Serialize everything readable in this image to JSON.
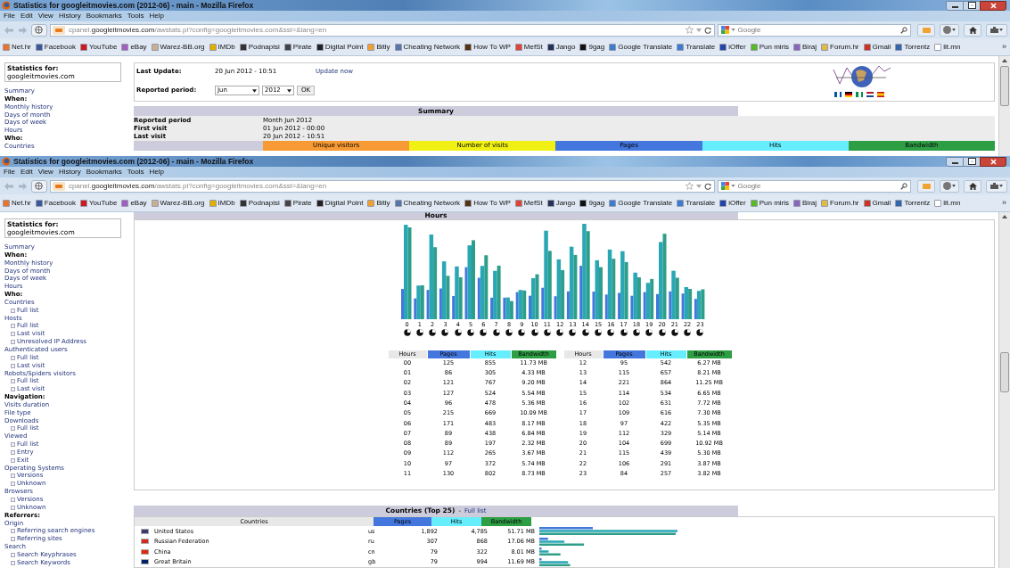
{
  "windows": [
    {
      "title": "Statistics for googleitmovies.com (2012-06) - main - Mozilla Firefox",
      "menu": [
        "File",
        "Edit",
        "View",
        "History",
        "Bookmarks",
        "Tools",
        "Help"
      ],
      "url": {
        "prefix": "cpanel.",
        "domain": "googleitmovies.com",
        "path": "/awstats.pl?config=googleitmovies.com&ssl=&lang=en"
      },
      "search": {
        "placeholder": "Google"
      },
      "bookmarks": [
        {
          "label": "Net.hr",
          "color": "#e8742c"
        },
        {
          "label": "Facebook",
          "color": "#3b5998"
        },
        {
          "label": "YouTube",
          "color": "#cc181e"
        },
        {
          "label": "eBay",
          "color": "#a060c0"
        },
        {
          "label": "Warez-BB.org",
          "color": "#c8b090"
        },
        {
          "label": "IMDb",
          "color": "#e0b000"
        },
        {
          "label": "Podnapisi",
          "color": "#333333"
        },
        {
          "label": "Pirate",
          "color": "#444444"
        },
        {
          "label": "Digital Point",
          "color": "#222222"
        },
        {
          "label": "Bitly",
          "color": "#f0a030"
        },
        {
          "label": "Cheating Network",
          "color": "#5577aa"
        },
        {
          "label": "How To WP",
          "color": "#553311"
        },
        {
          "label": "MefSt",
          "color": "#dd4433"
        },
        {
          "label": "Jango",
          "color": "#223355"
        },
        {
          "label": "9gag",
          "color": "#111111"
        },
        {
          "label": "Google Translate",
          "color": "#3b7cd0"
        },
        {
          "label": "Translate",
          "color": "#3b7cd0"
        },
        {
          "label": "iOffer",
          "color": "#2244aa"
        },
        {
          "label": "Pun miris",
          "color": "#55bb22"
        },
        {
          "label": "Biraj",
          "color": "#8866bb"
        },
        {
          "label": "Forum.hr",
          "color": "#ddbb44"
        },
        {
          "label": "Gmail",
          "color": "#cc3322"
        },
        {
          "label": "Torrentz",
          "color": "#3366aa"
        },
        {
          "label": "lit.mn",
          "color": "#ffffff"
        }
      ],
      "overflow": "»",
      "page": {
        "stats_for": {
          "label": "Statistics for:",
          "domain": "googleitmovies.com"
        },
        "sidebar": [
          {
            "kind": "link",
            "label": "Summary"
          },
          {
            "kind": "heading",
            "label": "When:"
          },
          {
            "kind": "link",
            "label": "Monthly history"
          },
          {
            "kind": "link",
            "label": "Days of month"
          },
          {
            "kind": "link",
            "label": "Days of week"
          },
          {
            "kind": "link",
            "label": "Hours"
          },
          {
            "kind": "heading",
            "label": "Who:"
          },
          {
            "kind": "link",
            "label": "Countries"
          }
        ],
        "update": {
          "last_label": "Last Update:",
          "last_value": "20 Jun 2012 - 10:51",
          "update_link": "Update now",
          "period_label": "Reported period:",
          "month": "Jun",
          "year": "2012",
          "ok": "OK"
        },
        "summary": {
          "title": "Summary",
          "rows": [
            [
              "Reported period",
              "Month Jun 2012"
            ],
            [
              "First visit",
              "01 Jun 2012 - 00:00"
            ],
            [
              "Last visit",
              "20 Jun 2012 - 10:51"
            ]
          ],
          "metrics": [
            {
              "label": "Unique visitors",
              "color": "#f89a33"
            },
            {
              "label": "Number of visits",
              "color": "#f0f015"
            },
            {
              "label": "Pages",
              "color": "#4477dd"
            },
            {
              "label": "Hits",
              "color": "#66eeff"
            },
            {
              "label": "Bandwidth",
              "color": "#2e9e45"
            }
          ]
        }
      }
    },
    {
      "title": "Statistics for googleitmovies.com (2012-06) - main - Mozilla Firefox",
      "menu": [
        "File",
        "Edit",
        "View",
        "History",
        "Bookmarks",
        "Tools",
        "Help"
      ],
      "url": {
        "prefix": "cpanel.",
        "domain": "googleitmovies.com",
        "path": "/awstats.pl?config=googleitmovies.com&ssl=&lang=en"
      },
      "search": {
        "placeholder": "Google"
      },
      "bookmarks": [
        {
          "label": "Net.hr",
          "color": "#e8742c"
        },
        {
          "label": "Facebook",
          "color": "#3b5998"
        },
        {
          "label": "YouTube",
          "color": "#cc181e"
        },
        {
          "label": "eBay",
          "color": "#a060c0"
        },
        {
          "label": "Warez-BB.org",
          "color": "#c8b090"
        },
        {
          "label": "IMDb",
          "color": "#e0b000"
        },
        {
          "label": "Podnapisi",
          "color": "#333333"
        },
        {
          "label": "Pirate",
          "color": "#444444"
        },
        {
          "label": "Digital Point",
          "color": "#222222"
        },
        {
          "label": "Bitly",
          "color": "#f0a030"
        },
        {
          "label": "Cheating Network",
          "color": "#5577aa"
        },
        {
          "label": "How To WP",
          "color": "#553311"
        },
        {
          "label": "MefSt",
          "color": "#dd4433"
        },
        {
          "label": "Jango",
          "color": "#223355"
        },
        {
          "label": "9gag",
          "color": "#111111"
        },
        {
          "label": "Google Translate",
          "color": "#3b7cd0"
        },
        {
          "label": "Translate",
          "color": "#3b7cd0"
        },
        {
          "label": "iOffer",
          "color": "#2244aa"
        },
        {
          "label": "Pun miris",
          "color": "#55bb22"
        },
        {
          "label": "Biraj",
          "color": "#8866bb"
        },
        {
          "label": "Forum.hr",
          "color": "#ddbb44"
        },
        {
          "label": "Gmail",
          "color": "#cc3322"
        },
        {
          "label": "Torrentz",
          "color": "#3366aa"
        },
        {
          "label": "lit.mn",
          "color": "#ffffff"
        }
      ],
      "overflow": "»",
      "page": {
        "stats_for": {
          "label": "Statistics for:",
          "domain": "googleitmovies.com"
        },
        "sidebar": [
          {
            "kind": "link",
            "label": "Summary"
          },
          {
            "kind": "heading",
            "label": "When:"
          },
          {
            "kind": "link",
            "label": "Monthly history"
          },
          {
            "kind": "link",
            "label": "Days of month"
          },
          {
            "kind": "link",
            "label": "Days of week"
          },
          {
            "kind": "link",
            "label": "Hours"
          },
          {
            "kind": "heading",
            "label": "Who:"
          },
          {
            "kind": "link",
            "label": "Countries",
            "children": [
              {
                "label": "Full list"
              }
            ]
          },
          {
            "kind": "link",
            "label": "Hosts",
            "children": [
              {
                "label": "Full list"
              },
              {
                "label": "Last visit"
              },
              {
                "label": "Unresolved IP Address"
              }
            ]
          },
          {
            "kind": "link",
            "label": "Authenticated users",
            "children": [
              {
                "label": "Full list"
              },
              {
                "label": "Last visit"
              }
            ]
          },
          {
            "kind": "link",
            "label": "Robots/Spiders visitors",
            "children": [
              {
                "label": "Full list"
              },
              {
                "label": "Last visit"
              }
            ]
          },
          {
            "kind": "heading",
            "label": "Navigation:"
          },
          {
            "kind": "link",
            "label": "Visits duration"
          },
          {
            "kind": "link",
            "label": "File type"
          },
          {
            "kind": "link",
            "label": "Downloads",
            "children": [
              {
                "label": "Full list"
              }
            ]
          },
          {
            "kind": "link",
            "label": "Viewed",
            "children": [
              {
                "label": "Full list"
              },
              {
                "label": "Entry"
              },
              {
                "label": "Exit"
              }
            ]
          },
          {
            "kind": "link",
            "label": "Operating Systems",
            "children": [
              {
                "label": "Versions"
              },
              {
                "label": "Unknown"
              }
            ]
          },
          {
            "kind": "link",
            "label": "Browsers",
            "children": [
              {
                "label": "Versions"
              },
              {
                "label": "Unknown"
              }
            ]
          },
          {
            "kind": "heading",
            "label": "Referrers:"
          },
          {
            "kind": "link",
            "label": "Origin",
            "children": [
              {
                "label": "Referring search engines"
              },
              {
                "label": "Referring sites"
              }
            ]
          },
          {
            "kind": "link",
            "label": "Search",
            "children": [
              {
                "label": "Search Keyphrases"
              },
              {
                "label": "Search Keywords"
              }
            ]
          }
        ],
        "hours": {
          "title": "Hours",
          "hour_labels": [
            "0",
            "1",
            "2",
            "3",
            "4",
            "5",
            "6",
            "7",
            "8",
            "9",
            "10",
            "11",
            "12",
            "13",
            "14",
            "15",
            "16",
            "17",
            "18",
            "19",
            "20",
            "21",
            "22",
            "23"
          ],
          "halves": [
            {
              "columns": [
                "Hours",
                "Pages",
                "Hits",
                "Bandwidth"
              ],
              "rows": [
                [
                  "00",
                  "125",
                  "855",
                  "11.73 MB"
                ],
                [
                  "01",
                  "86",
                  "305",
                  "4.33 MB"
                ],
                [
                  "02",
                  "121",
                  "767",
                  "9.20 MB"
                ],
                [
                  "03",
                  "127",
                  "524",
                  "5.54 MB"
                ],
                [
                  "04",
                  "96",
                  "478",
                  "5.36 MB"
                ],
                [
                  "05",
                  "215",
                  "669",
                  "10.09 MB"
                ],
                [
                  "06",
                  "171",
                  "483",
                  "8.17 MB"
                ],
                [
                  "07",
                  "89",
                  "438",
                  "6.84 MB"
                ],
                [
                  "08",
                  "89",
                  "197",
                  "2.32 MB"
                ],
                [
                  "09",
                  "112",
                  "265",
                  "3.67 MB"
                ],
                [
                  "10",
                  "97",
                  "372",
                  "5.74 MB"
                ],
                [
                  "11",
                  "130",
                  "802",
                  "8.73 MB"
                ]
              ]
            },
            {
              "columns": [
                "Hours",
                "Pages",
                "Hits",
                "Bandwidth"
              ],
              "rows": [
                [
                  "12",
                  "95",
                  "542",
                  "6.27 MB"
                ],
                [
                  "13",
                  "115",
                  "657",
                  "8.21 MB"
                ],
                [
                  "14",
                  "221",
                  "864",
                  "11.25 MB"
                ],
                [
                  "15",
                  "114",
                  "534",
                  "6.65 MB"
                ],
                [
                  "16",
                  "102",
                  "631",
                  "7.72 MB"
                ],
                [
                  "17",
                  "109",
                  "616",
                  "7.30 MB"
                ],
                [
                  "18",
                  "97",
                  "422",
                  "5.35 MB"
                ],
                [
                  "19",
                  "112",
                  "329",
                  "5.14 MB"
                ],
                [
                  "20",
                  "104",
                  "699",
                  "10.92 MB"
                ],
                [
                  "21",
                  "115",
                  "439",
                  "5.30 MB"
                ],
                [
                  "22",
                  "106",
                  "291",
                  "3.87 MB"
                ],
                [
                  "23",
                  "84",
                  "257",
                  "3.82 MB"
                ]
              ]
            }
          ]
        },
        "countries": {
          "title": "Countries (Top 25)",
          "separator": "-",
          "full_list": "Full list",
          "columns": [
            "Countries",
            "Pages",
            "Hits",
            "Bandwidth"
          ],
          "rows": [
            {
              "name": "United States",
              "code": "us",
              "pages": "1,892",
              "hits": "4,785",
              "bandwidth": "51.71 MB",
              "color": "#3c3b6e"
            },
            {
              "name": "Russian Federation",
              "code": "ru",
              "pages": "307",
              "hits": "868",
              "bandwidth": "17.06 MB",
              "color": "#d52b1e"
            },
            {
              "name": "China",
              "code": "cn",
              "pages": "79",
              "hits": "322",
              "bandwidth": "8.01 MB",
              "color": "#de2910"
            },
            {
              "name": "Great Britain",
              "code": "gb",
              "pages": "79",
              "hits": "994",
              "bandwidth": "11.69 MB",
              "color": "#012169"
            }
          ]
        }
      }
    }
  ]
}
